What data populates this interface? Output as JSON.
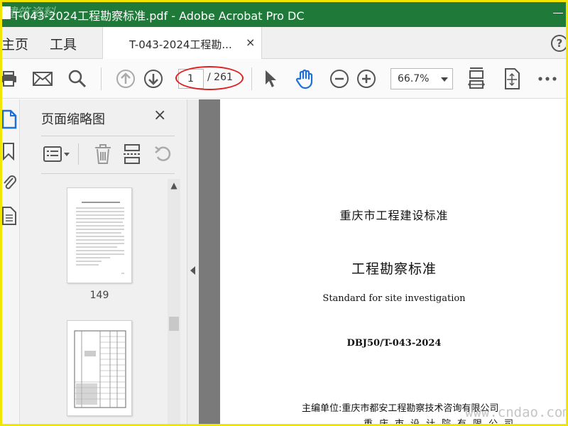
{
  "window": {
    "title": "T-043-2024工程勘察标准.pdf - Adobe Acrobat Pro DC",
    "watermark": "建筑资料"
  },
  "tabbar": {
    "home_label": "主页",
    "tools_label": "工具",
    "doc_tab_label": "T-043-2024工程勘...",
    "doc_tab_close": "×",
    "help_label": "?"
  },
  "toolbar": {
    "current_page": "1",
    "total_pages": "/ 261",
    "zoom": "66.7%",
    "icons": [
      "print-icon",
      "email-icon",
      "search-icon",
      "page-up-icon",
      "page-down-icon",
      "select-cursor-icon",
      "hand-tool-icon",
      "zoom-out-icon",
      "zoom-in-icon",
      "scroll-mode-icon",
      "fit-page-icon",
      "more-icon"
    ],
    "annotation_color": "#e02020"
  },
  "sidebar": {
    "icons": [
      "pages-icon",
      "bookmark-icon",
      "attachment-icon",
      "layers-icon"
    ]
  },
  "thumbnails_panel": {
    "title": "页面缩略图",
    "close": "×",
    "thumbnails": [
      {
        "page_label": "149"
      },
      {
        "page_label": ""
      }
    ]
  },
  "document": {
    "org": "重庆市工程建设标准",
    "title": "工程勘察标准",
    "english_title": "Standard for site investigation",
    "code": "DBJ50/T-043-2024",
    "chief_editor": "主编单位:重庆市都安工程勘察技术咨询有限公司",
    "co_editor": "重庆市设计院有限公司"
  },
  "site_watermark": "www.cndao.com",
  "colors": {
    "titlebar": "#1f7a3a",
    "frame": "#f2e600"
  }
}
